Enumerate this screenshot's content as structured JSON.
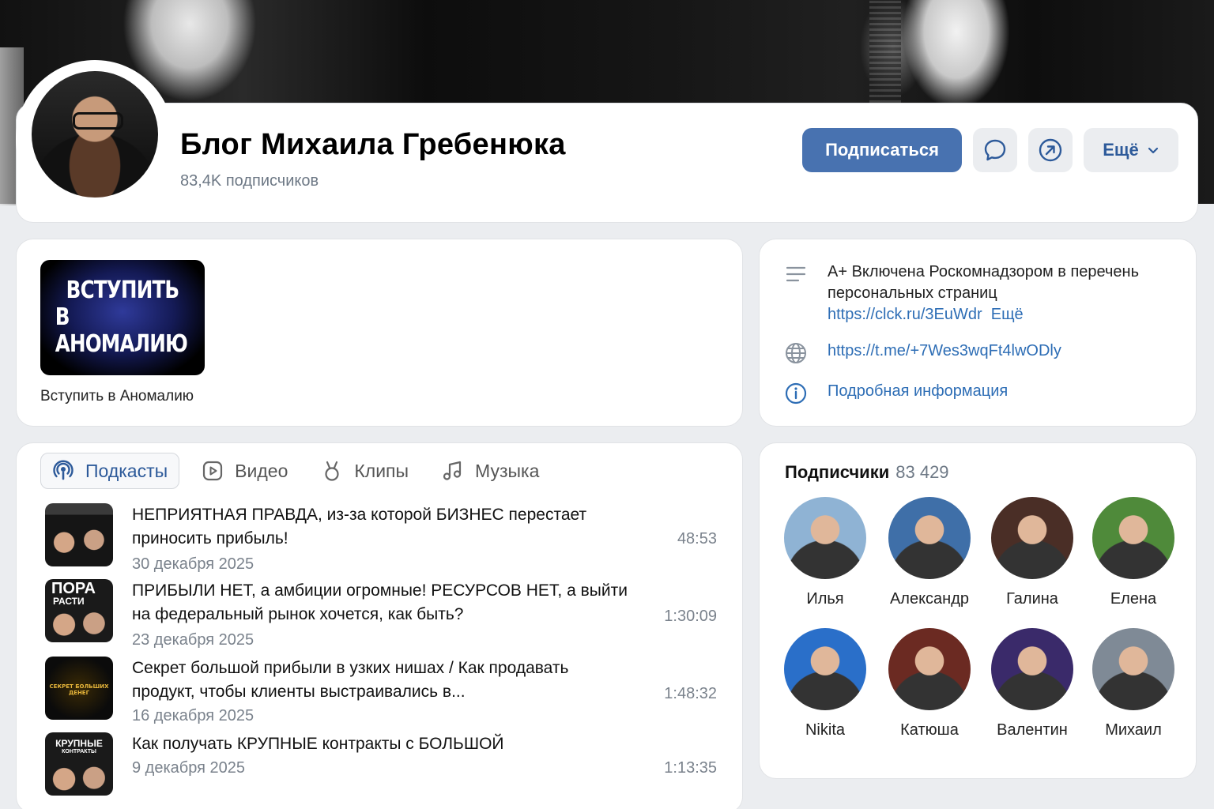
{
  "header": {
    "title": "Блог Михаила Гребенюка",
    "subscribers": "83,4K подписчиков",
    "subscribe_button": "Подписаться",
    "more_button": "Ещё"
  },
  "join": {
    "thumb_line1": "ВСТУПИТЬ",
    "thumb_line2": "В АНОМАЛИЮ",
    "label": "Вступить в Аномалию"
  },
  "info": {
    "status_line1": "A+ Включена Роскомнадзором в перечень",
    "status_line2": "персональных страниц",
    "status_link": "https://clck.ru/3EuWdr",
    "status_more": "Ещё",
    "telegram_link": "https://t.me/+7Wes3wqFt4lwODly",
    "details_link": "Подробная информация"
  },
  "tabs": [
    {
      "label": "Подкасты",
      "active": true
    },
    {
      "label": "Видео",
      "active": false
    },
    {
      "label": "Клипы",
      "active": false
    },
    {
      "label": "Музыка",
      "active": false
    }
  ],
  "podcasts": [
    {
      "title": "НЕПРИЯТНАЯ ПРАВДА, из-за которой БИЗНЕС перестает приносить прибыль!",
      "date": "30 декабря 2025",
      "duration": "48:53"
    },
    {
      "title": "ПРИБЫЛИ НЕТ, а амбиции огромные! РЕСУРСОВ НЕТ, а выйти на федеральный рынок хочется, как быть?",
      "date": "23 декабря 2025",
      "duration": "1:30:09",
      "thumb_text1": "ПОРА",
      "thumb_text2": "РАСТИ"
    },
    {
      "title": "Секрет большой прибыли в узких нишах / Как продавать продукт, чтобы клиенты выстраивались в...",
      "date": "16 декабря 2025",
      "duration": "1:48:32",
      "thumb_text1": "СЕКРЕТ БОЛЬШИХ ДЕНЕГ"
    },
    {
      "title": "Как получать КРУПНЫЕ контракты с БОЛЬШОЙ",
      "date": "9 декабря 2025",
      "duration": "1:13:35",
      "thumb_text1": "КРУПНЫЕ",
      "thumb_text2": "КОНТРАКТЫ"
    }
  ],
  "followers": {
    "title": "Подписчики",
    "count": "83 429",
    "people": [
      {
        "name": "Илья",
        "color": "#8fb3d4"
      },
      {
        "name": "Александр",
        "color": "#3f6fa8"
      },
      {
        "name": "Галина",
        "color": "#4a2e26"
      },
      {
        "name": "Елена",
        "color": "#4f8a3a"
      },
      {
        "name": "Nikita",
        "color": "#2a6fc9"
      },
      {
        "name": "Катюша",
        "color": "#6b2a22"
      },
      {
        "name": "Валентин",
        "color": "#3a2a6a"
      },
      {
        "name": "Михаил",
        "color": "#7f8a96"
      }
    ]
  },
  "colors": {
    "accent": "#4872b0",
    "link": "#2d6db5",
    "background": "#ebedf0"
  }
}
